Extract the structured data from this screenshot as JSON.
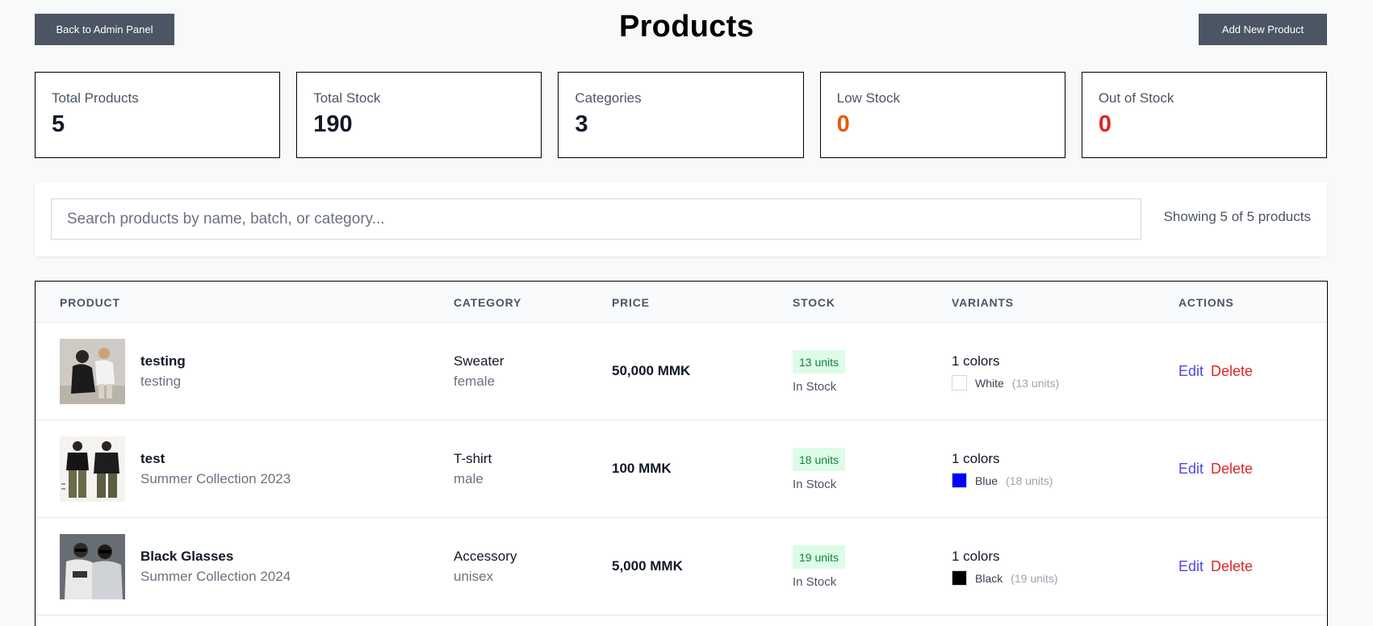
{
  "header": {
    "back_label": "Back to Admin Panel",
    "title": "Products",
    "add_label": "Add New Product"
  },
  "stats": [
    {
      "label": "Total Products",
      "value": "5",
      "color": "#111827"
    },
    {
      "label": "Total Stock",
      "value": "190",
      "color": "#111827"
    },
    {
      "label": "Categories",
      "value": "3",
      "color": "#111827"
    },
    {
      "label": "Low Stock",
      "value": "0",
      "color": "#ea580c"
    },
    {
      "label": "Out of Stock",
      "value": "0",
      "color": "#dc2626"
    }
  ],
  "search": {
    "placeholder": "Search products by name, batch, or category...",
    "value": "",
    "showing": "Showing 5 of 5 products"
  },
  "table": {
    "headers": {
      "product": "PRODUCT",
      "category": "CATEGORY",
      "price": "PRICE",
      "stock": "STOCK",
      "variants": "VARIANTS",
      "actions": "ACTIONS"
    },
    "rows": [
      {
        "name": "testing",
        "sub": "testing",
        "category": "Sweater",
        "gender": "female",
        "price": "50,000 MMK",
        "stock": "13 units",
        "stock_status": "In Stock",
        "variant_count": "1 colors",
        "variant_color_name": "White",
        "variant_swatch": "#ffffff",
        "variant_units": "(13 units)",
        "edit": "Edit",
        "delete": "Delete",
        "image_icon": "photo-two-people-icon"
      },
      {
        "name": "test",
        "sub": "Summer Collection 2023",
        "category": "T-shirt",
        "gender": "male",
        "price": "100 MMK",
        "stock": "18 units",
        "stock_status": "In Stock",
        "variant_count": "1 colors",
        "variant_color_name": "Blue",
        "variant_swatch": "#0000ff",
        "variant_units": "(18 units)",
        "edit": "Edit",
        "delete": "Delete",
        "image_icon": "photo-tshirt-models-icon"
      },
      {
        "name": "Black Glasses",
        "sub": "Summer Collection 2024",
        "category": "Accessory",
        "gender": "unisex",
        "price": "5,000 MMK",
        "stock": "19 units",
        "stock_status": "In Stock",
        "variant_count": "1 colors",
        "variant_color_name": "Black",
        "variant_swatch": "#000000",
        "variant_units": "(19 units)",
        "edit": "Edit",
        "delete": "Delete",
        "image_icon": "photo-glasses-models-icon"
      }
    ]
  }
}
